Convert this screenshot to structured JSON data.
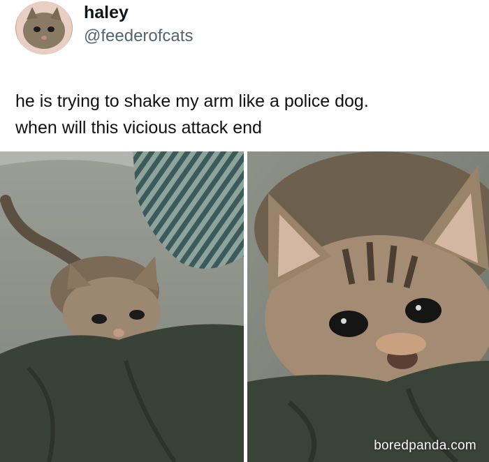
{
  "author": {
    "display_name": "haley",
    "handle": "@feederofcats"
  },
  "tweet": {
    "lines": [
      "he is trying to shake my arm like a police dog.",
      "when will this vicious attack end"
    ]
  },
  "watermark": "boredpanda.com",
  "photos": [
    {
      "subject": "kitten biting sleeve on couch"
    },
    {
      "subject": "kitten close-up biting sleeve"
    }
  ],
  "colors": {
    "couch": "#8d9188",
    "sleeve": "#394236",
    "kitten_fur": "#8c7a63"
  }
}
